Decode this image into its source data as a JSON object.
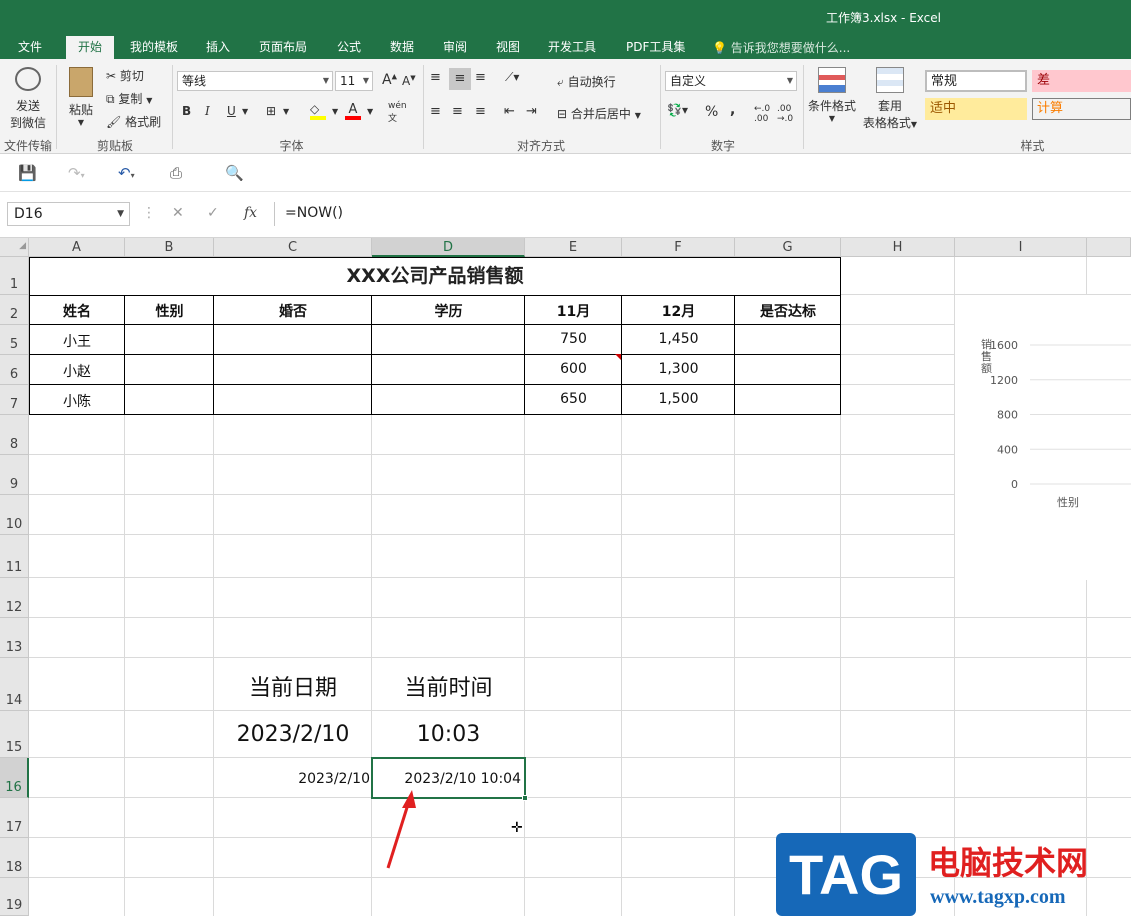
{
  "window": {
    "title": "工作簿3.xlsx - Excel"
  },
  "ribbon_tabs": [
    {
      "label": "文件",
      "active": false
    },
    {
      "label": "开始",
      "active": true
    },
    {
      "label": "我的模板",
      "active": false
    },
    {
      "label": "插入",
      "active": false
    },
    {
      "label": "页面布局",
      "active": false
    },
    {
      "label": "公式",
      "active": false
    },
    {
      "label": "数据",
      "active": false
    },
    {
      "label": "审阅",
      "active": false
    },
    {
      "label": "视图",
      "active": false
    },
    {
      "label": "开发工具",
      "active": false
    },
    {
      "label": "PDF工具集",
      "active": false
    }
  ],
  "tell_me": "告诉我您想要做什么...",
  "ribbon": {
    "send_wechat_line1": "发送",
    "send_wechat_line2": "到微信",
    "group_file_transfer": "文件传输",
    "paste": "粘贴",
    "cut": "剪切",
    "copy": "复制",
    "format_painter": "格式刷",
    "group_clipboard": "剪贴板",
    "font_name": "等线",
    "font_size": "11",
    "bold": "B",
    "italic": "I",
    "underline": "U",
    "group_font": "字体",
    "wrap_text": "自动换行",
    "merge_center": "合并后居中",
    "group_alignment": "对齐方式",
    "number_format": "自定义",
    "percent": "%",
    "comma": ",",
    "group_number": "数字",
    "conditional_format": "条件格式",
    "table_format_line1": "套用",
    "table_format_line2": "表格格式",
    "style_normal": "常规",
    "style_bad": "差",
    "style_neutral": "适中",
    "style_calc": "计算",
    "group_styles": "样式"
  },
  "formula_bar": {
    "name_box": "D16",
    "formula": "=NOW()",
    "fx": "fx"
  },
  "columns": [
    "A",
    "B",
    "C",
    "D",
    "E",
    "F",
    "G",
    "H",
    "I"
  ],
  "rows": [
    "1",
    "2",
    "5",
    "6",
    "7",
    "8",
    "9",
    "10",
    "11",
    "12",
    "13",
    "14",
    "15",
    "16",
    "17",
    "18",
    "19"
  ],
  "table": {
    "title": "XXX公司产品销售额",
    "headers": [
      "姓名",
      "性别",
      "婚否",
      "学历",
      "11月",
      "12月",
      "是否达标"
    ],
    "rows": [
      [
        "小王",
        "",
        "",
        "",
        "750",
        "1,450",
        ""
      ],
      [
        "小赵",
        "",
        "",
        "",
        "600",
        "1,300",
        ""
      ],
      [
        "小陈",
        "",
        "",
        "",
        "650",
        "1,500",
        ""
      ]
    ]
  },
  "labels": {
    "current_date": "当前日期",
    "current_time": "当前时间",
    "date_value": "2023/2/10",
    "time_value": "10:03",
    "today_result": "2023/2/10",
    "now_result": "2023/2/10 10:04"
  },
  "chart_data": {
    "type": "bar",
    "categories": [
      "性别"
    ],
    "series": [],
    "title": "",
    "ylabel": "销售额",
    "yticks": [
      "1600",
      "1200",
      "800",
      "400",
      "0"
    ],
    "ylim": [
      0,
      1600
    ]
  },
  "watermark": {
    "logo": "TAG",
    "site_name": "电脑技术网",
    "url": "www.tagxp.com"
  },
  "colors": {
    "excel_green": "#217346",
    "bad_bg": "#ffc7ce",
    "bad_fg": "#9c0006",
    "neutral_bg": "#ffeb9c",
    "neutral_fg": "#9c5700",
    "calc_fg": "#fa7d00"
  }
}
